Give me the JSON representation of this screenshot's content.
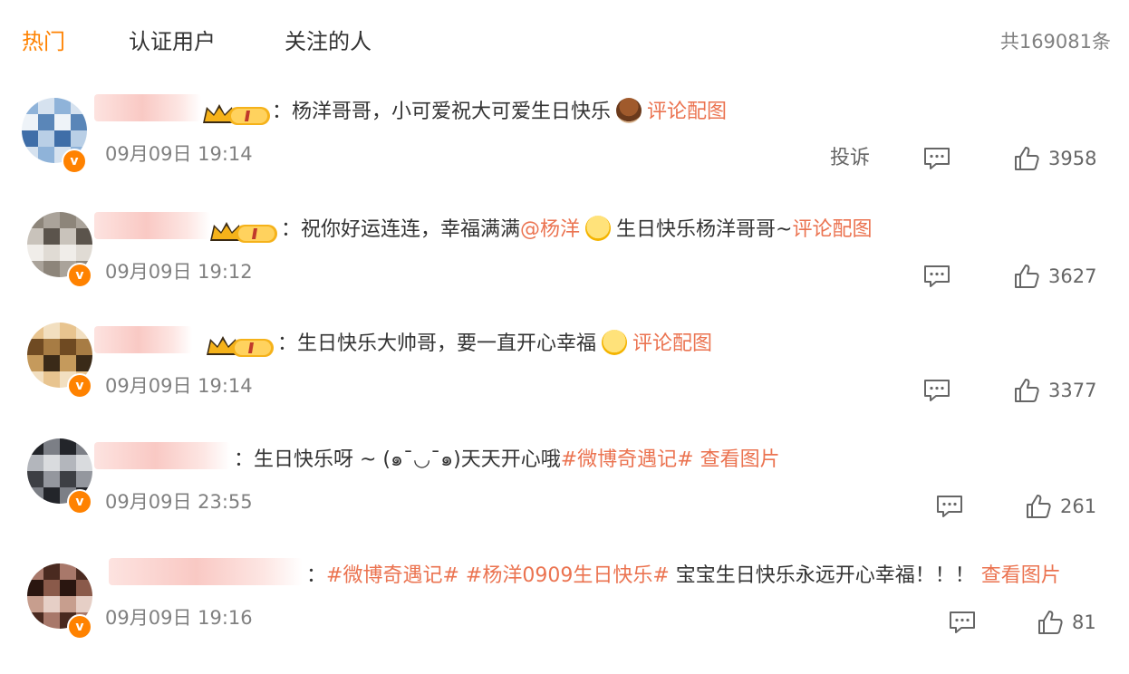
{
  "tabs": {
    "hot": "热门",
    "verified": "认证用户",
    "following": "关注的人"
  },
  "total": "共169081条",
  "icons": {
    "comment": "comment-icon",
    "like": "thumbs-up-icon",
    "verified": "verified-badge-icon",
    "vip": "vip-crown-icon"
  },
  "colors": {
    "accent": "#ff8200",
    "link": "#eb7350"
  },
  "comments": [
    {
      "segments": [
        {
          "t": "：杨洋哥哥，小可爱祝大可爱生日快乐",
          "c": ""
        },
        {
          "t": "",
          "c": "emo-cake"
        },
        {
          "t": "评论配图",
          "c": "hl"
        }
      ],
      "time": "09月09日 19:14",
      "report": "投诉",
      "likes": "3958"
    },
    {
      "segments": [
        {
          "t": "：祝你好运连连，幸福满满",
          "c": ""
        },
        {
          "t": "@杨洋",
          "c": "hl"
        },
        {
          "t": "",
          "c": "emo-face"
        },
        {
          "t": "生日快乐杨洋哥哥~",
          "c": ""
        },
        {
          "t": "评论配图",
          "c": "hl"
        }
      ],
      "time": "09月09日 19:12",
      "likes": "3627"
    },
    {
      "segments": [
        {
          "t": "：生日快乐大帅哥，要一直开心幸福",
          "c": ""
        },
        {
          "t": "",
          "c": "emo-face"
        },
        {
          "t": "评论配图",
          "c": "hl"
        }
      ],
      "time": "09月09日 19:14",
      "likes": "3377"
    },
    {
      "segments": [
        {
          "t": "：生日快乐呀 ~ (๑¯◡¯๑)天天开心哦",
          "c": ""
        },
        {
          "t": "#微博奇遇记#",
          "c": "hl"
        },
        {
          "t": " 查看图片",
          "c": "hl"
        }
      ],
      "time": "09月09日 23:55",
      "likes": "261"
    },
    {
      "segments": [
        {
          "t": "：",
          "c": ""
        },
        {
          "t": "#微博奇遇记#",
          "c": "hl"
        },
        {
          "t": " ",
          "c": ""
        },
        {
          "t": "#杨洋0909生日快乐#",
          "c": "hl"
        },
        {
          "t": " 宝宝生日快乐永远开心幸福！！！ ",
          "c": ""
        },
        {
          "t": "查看图片",
          "c": "hl"
        }
      ],
      "time": "09月09日 19:16",
      "likes": "81"
    }
  ]
}
